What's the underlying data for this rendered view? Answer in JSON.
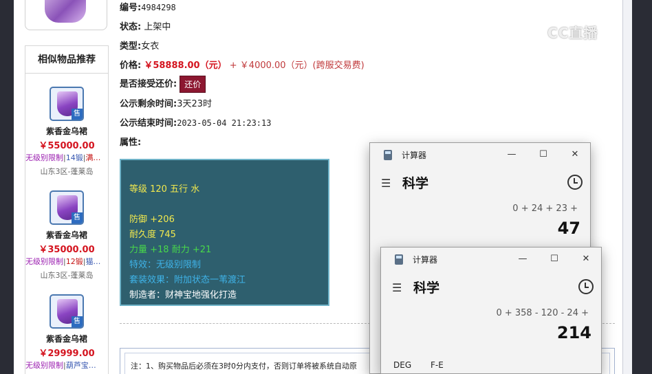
{
  "listing": {
    "id_label": "编号:",
    "id_value": "4984298",
    "status_label": "状态:",
    "status_value": "上架中",
    "type_label": "类型:",
    "type_value": "女衣",
    "price_label": "价格:",
    "price_value": "￥58888.00（元）",
    "price_plus": "+",
    "fee_value": "￥4000.00（元）(跨服交易费)",
    "counter_label": "是否接受还价:",
    "counter_button": "还价",
    "remaining_label": "公示剩余时间:",
    "remaining_value": "3天23时",
    "end_label": "公示结束时间:",
    "end_value": "2023-05-04 21:23:13",
    "attr_label": "属性:"
  },
  "attributes": {
    "line1": "等级 120 五行 水",
    "line2": "防御 +206",
    "line3": "耐久度 745",
    "line4": "力量 +18 耐力 +21",
    "line5": "特效：无级别限制",
    "line6": "套装效果：附加状态一苇渡江",
    "line7": "制造者：财神宝地强化打造"
  },
  "recommendations": {
    "title": "相似物品推荐",
    "items": [
      {
        "name": "紫香金乌裙",
        "price": "￥55000.00",
        "tag1": "无级别限制",
        "tag2": "14锻",
        "tag3": "满…",
        "server": "山东3区-蓬莱岛",
        "badge": "售"
      },
      {
        "name": "紫香金乌裙",
        "price": "￥35000.00",
        "tag1": "无级别限制",
        "tag2": "12锻",
        "tag3": "猫…",
        "server": "山东3区-蓬莱岛",
        "badge": "售"
      },
      {
        "name": "紫香金乌裙",
        "price": "￥29999.00",
        "tag1": "无级别限制",
        "tag2": "葫芦宝…",
        "tag3": "",
        "server": "",
        "badge": "售"
      }
    ]
  },
  "notice": {
    "text": "注：1、购买物品后必须在3时0分内支付，否则订单将被系统自动原"
  },
  "watermark": {
    "text": "CC直播"
  },
  "calculator_back": {
    "title": "计算器",
    "mode": "科学",
    "expression": "0 + 24 + 23 +",
    "result": "47",
    "minimize": "—",
    "maximize": "☐",
    "close": "✕"
  },
  "calculator_front": {
    "title": "计算器",
    "mode": "科学",
    "expression": "0 + 358 - 120 - 24 +",
    "result": "214",
    "deg": "DEG",
    "fe": "F-E",
    "minimize": "—",
    "maximize": "☐",
    "close": "✕"
  },
  "colors": {
    "price": "#d4141f",
    "attr_bg": "#2e5f6e",
    "attr_yellow": "#f2e94e",
    "attr_green": "#48d84a",
    "attr_blue": "#3fb3e8",
    "counter_btn": "#8c1730"
  }
}
